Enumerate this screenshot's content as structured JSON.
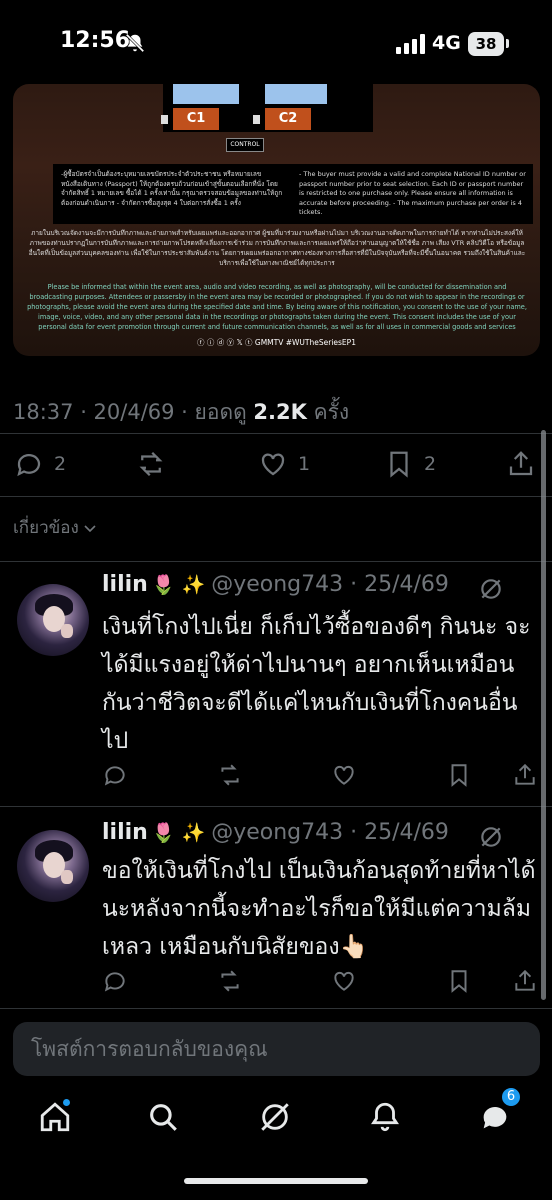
{
  "status_bar": {
    "time": "12:56",
    "network": "4G",
    "battery": "38"
  },
  "poster": {
    "zone_left": "C1",
    "zone_right": "C2",
    "control_label": "CONTROL",
    "terms_th": "-ผู้ซื้อบัตรจำเป็นต้องระบุหมายเลขบัตรประจำตัวประชาชน หรือหมายเลขหนังสือเดินทาง (Passport) ให้ถูกต้องครบถ้วนก่อนเข้าสู่ขั้นตอนเลือกที่นั่ง โดยจำกัดสิทธิ์ 1 หมายเลข ซื้อได้ 1 ครั้งเท่านั้น กรุณาตรวจสอบข้อมูลของท่านให้ถูกต้องก่อนดำเนินการ - จำกัดการซื้อสูงสุด 4 ใบต่อการสั่งซื้อ 1 ครั้ง",
    "terms_en": "- The buyer must provide a valid and complete National ID number or passport number prior to seat selection. Each ID or passport number is restricted to one purchase only. Please ensure all information is accurate before proceeding. - The maximum purchase per order is 4 tickets.",
    "notice_th": "ภายในบริเวณจัดงานจะมีการบันทึกภาพและถ่ายภาพสำหรับเผยแพร่และออกอากาศ ผู้ชมที่มาร่วมงานหรือผ่านไปมา บริเวณงานอาจติดภาพในการถ่ายทำได้ หากท่านไม่ประสงค์ให้ภาพของท่านปรากฏในการบันทึกภาพและการถ่ายภาพโปรดหลีกเลี่ยงการเข้าร่วม การบันทึกภาพและการเผยแพร่ให้ถือว่าท่านอนุญาตให้ใช้ชื่อ ภาพ เสียง VTR คลิปวิดีโอ หรือข้อมูลอื่นใดที่เป็นข้อมูลส่วนบุคคลของท่าน เพื่อใช้ในการประชาสัมพันธ์งาน โดยการเผยแพร่ออกอากาศทางช่องทางการสื่อสารที่มีในปัจจุบันหรือที่จะมีขึ้นในอนาคต รวมถึงใช้ในสินค้าและบริการเพื่อใช้ในทางพาณิชย์ได้ทุกประการ",
    "notice_en": "Please be informed that within the event area, audio and video recording, as well as photography, will be conducted for dissemination and broadcasting purposes. Attendees or passersby in the event area may be recorded or photographed. If you do not wish to appear in the recordings or photographs, please avoid the event area during the specified date and time. By being aware of this notification, you consent to the use of your name, image, voice, video, and any other personal data in the recordings or photographs taken during the event. This consent includes the use of your personal data for event promotion through current and future communication channels, as well as for all uses in commercial goods and services",
    "social_line": "ⓕ ⓘ ⓓ ⓨ 𝕏 ⓣ GMMTV #WUTheSeriesEP1"
  },
  "tweet_meta": {
    "time_date": "18:37 · 20/4/69 · ยอดดู ",
    "views": "2.2K",
    "views_suffix": " ครั้ง"
  },
  "tweet_actions": {
    "replies": "2",
    "likes": "1",
    "bookmarks": "2"
  },
  "related_label": "เกี่ยวข้อง",
  "replies": [
    {
      "name": "lilin",
      "emoji": "🌷 ✨",
      "handle": "@yeong743 · 25/4/69",
      "text": "เงินที่โกงไปเนี่ย ก็เก็บไว้ซื้อของดีๆ กินนะ จะได้มีแรงอยู่ให้ด่าไปนานๆ อยากเห็นเหมือนกันว่าชีวิตจะดีได้แค่ไหนกับเงินที่โกงคนอื่นไป"
    },
    {
      "name": "lilin",
      "emoji": "🌷 ✨",
      "handle": "@yeong743 · 25/4/69",
      "text": "ขอให้เงินที่โกงไป เป็นเงินก้อนสุดท้ายที่หาได้นะหลังจากนี้จะทำอะไรก็ขอให้มีแต่ความล้มเหลว เหมือนกับนิสัยของ👆🏻"
    }
  ],
  "compose": {
    "placeholder": "โพสต์การตอบกลับของคุณ"
  },
  "tabbar": {
    "messages_badge": "6"
  },
  "colors": {
    "accent": "#1d9bf0",
    "muted": "#71767b",
    "background": "#000000"
  }
}
